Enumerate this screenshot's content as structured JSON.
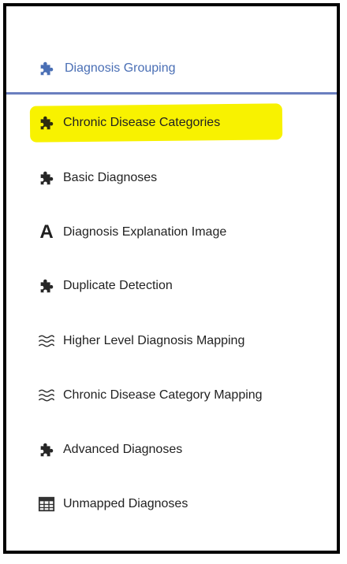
{
  "header": {
    "label": "Diagnosis Grouping",
    "icon": "puzzle-piece-icon",
    "accent_color": "#6a7fbf",
    "label_color": "#4a6fb5"
  },
  "menu": {
    "items": [
      {
        "label": "Chronic Disease Categories",
        "icon": "puzzle-piece-icon",
        "highlighted": true
      },
      {
        "label": "Basic Diagnoses",
        "icon": "puzzle-piece-icon"
      },
      {
        "label": "Diagnosis Explanation Image",
        "icon": "text-letter-a-icon"
      },
      {
        "label": "Duplicate Detection",
        "icon": "puzzle-piece-icon"
      },
      {
        "label": "Higher Level Diagnosis Mapping",
        "icon": "wave-lines-icon"
      },
      {
        "label": "Chronic Disease Category Mapping",
        "icon": "wave-lines-icon"
      },
      {
        "label": "Advanced Diagnoses",
        "icon": "puzzle-piece-icon"
      },
      {
        "label": "Unmapped Diagnoses",
        "icon": "table-grid-icon"
      }
    ]
  },
  "highlight_color": "#f8f200"
}
